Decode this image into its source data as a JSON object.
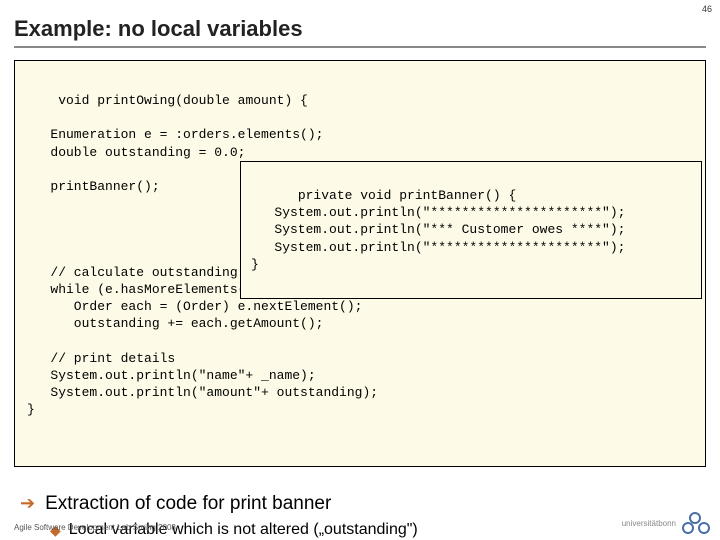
{
  "pagenum": "46",
  "title": "Example: no local variables",
  "code": {
    "main": "void printOwing(double amount) {\n\n   Enumeration e = :orders.elements();\n   double outstanding = 0.0;\n\n   printBanner();\n\n\n\n\n   // calculate outstanding\n   while (e.hasMoreElements()) {\n      Order each = (Order) e.nextElement();\n      outstanding += each.getAmount();\n\n   // print details\n   System.out.println(\"name\"+ _name);\n   System.out.println(\"amount\"+ outstanding);\n}",
    "overlay": "private void printBanner() {\n   System.out.println(\"**********************\");\n   System.out.println(\"*** Customer owes ****\");\n   System.out.println(\"**********************\");\n}"
  },
  "bullets": {
    "level1": "Extraction of code for print banner",
    "level2": "Local variable which is not altered („outstanding\")"
  },
  "footer": "Agile Software Development Lab Spring 2008",
  "logo_text": "universitätbonn"
}
